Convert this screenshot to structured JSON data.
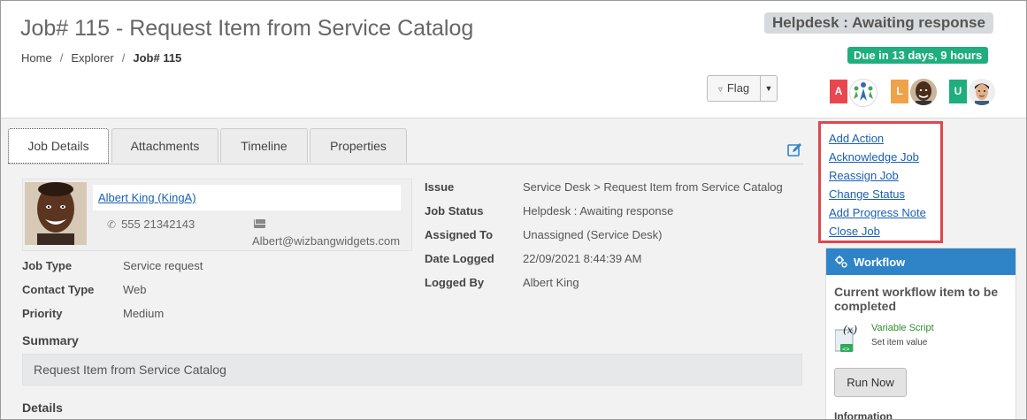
{
  "header": {
    "title": "Job# 115 - Request Item from Service Catalog",
    "breadcrumbs": [
      "Home",
      "Explorer",
      "Job# 115"
    ],
    "breadcrumb_sep": "/",
    "status": "Helpdesk : Awaiting response",
    "due": "Due in 13 days, 9 hours",
    "flag_label": "Flag",
    "avatars": [
      {
        "badge": "A",
        "color": "#e8474f"
      },
      {
        "badge": "L",
        "color": "#f0a24a"
      },
      {
        "badge": "U",
        "color": "#1fae7e"
      }
    ]
  },
  "tabs": [
    "Job Details",
    "Attachments",
    "Timeline",
    "Properties"
  ],
  "contact": {
    "name": "Albert King (KingA)",
    "phone": "555 21342143",
    "email": "Albert@wizbangwidgets.com"
  },
  "details_left": [
    {
      "label": "Job Type",
      "value": "Service request"
    },
    {
      "label": "Contact Type",
      "value": "Web"
    },
    {
      "label": "Priority",
      "value": "Medium"
    }
  ],
  "details_right": [
    {
      "label": "Issue",
      "value": "Service Desk > Request Item from Service Catalog"
    },
    {
      "label": "Job Status",
      "value": "Helpdesk : Awaiting response"
    },
    {
      "label": "Assigned To",
      "value": "Unassigned (Service Desk)"
    },
    {
      "label": "Date Logged",
      "value": "22/09/2021 8:44:39 AM"
    },
    {
      "label": "Logged By",
      "value": "Albert King"
    }
  ],
  "summary": {
    "heading": "Summary",
    "text": "Request Item from Service Catalog"
  },
  "details_heading": "Details",
  "actions": [
    "Add Action",
    "Acknowledge Job",
    "Reassign Job",
    "Change Status",
    "Add Progress Note",
    "Close Job"
  ],
  "workflow": {
    "title": "Workflow",
    "subtitle": "Current workflow item to be completed",
    "item_name": "Variable Script",
    "item_desc": "Set item value",
    "run_label": "Run Now",
    "info_label": "Information"
  },
  "colors": {
    "accent_blue": "#2f84c7",
    "due_green": "#1fae7e",
    "highlight_red": "#e0474c",
    "link_blue": "#1a5fb4"
  }
}
